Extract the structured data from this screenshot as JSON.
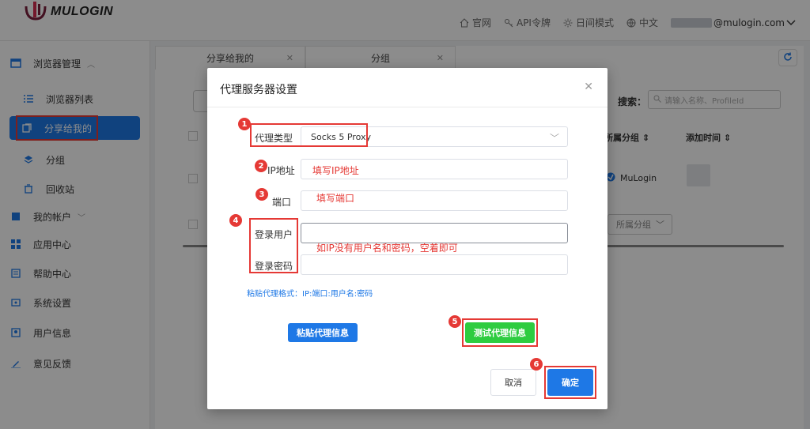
{
  "header": {
    "logo_text": "MULOGIN",
    "nav": [
      {
        "label": "官网",
        "icon": "home-icon"
      },
      {
        "label": "API令牌",
        "icon": "key-icon"
      },
      {
        "label": "日间模式",
        "icon": "sun-icon"
      },
      {
        "label": "中文",
        "icon": "globe-icon"
      }
    ],
    "email_suffix": "@mulogin.com"
  },
  "sidebar": {
    "browser_mgmt": "浏览器管理",
    "browser_list": "浏览器列表",
    "shared_with_me": "分享给我的",
    "groups": "分组",
    "recycle_bin": "回收站",
    "my_account": "我的帐户",
    "app_center": "应用中心",
    "help_center": "帮助中心",
    "system_settings": "系统设置",
    "user_info": "用户信息",
    "feedback": "意见反馈"
  },
  "tabs": [
    {
      "label": "分享给我的"
    },
    {
      "label": "分组"
    }
  ],
  "table": {
    "search_label": "搜索：",
    "search_placeholder": "请输入名称、ProfileId",
    "col_group": "所属分组",
    "col_added": "添加时间",
    "row_group": "MuLogin",
    "group_filter": "所属分组"
  },
  "modal": {
    "title": "代理服务器设置",
    "proxy_type_label": "代理类型",
    "proxy_type_value": "Socks 5 Proxy",
    "ip_label": "IP地址",
    "ip_note": "填写IP地址",
    "port_label": "端口",
    "port_note": "填写端口",
    "user_label": "登录用户",
    "password_label": "登录密码",
    "credentials_note": "如IP没有用户名和密码，空着即可",
    "paste_hint": "粘贴代理格式：IP:端口:用户名:密码",
    "paste_button": "粘贴代理信息",
    "test_button": "测试代理信息",
    "cancel_button": "取消",
    "ok_button": "确定"
  },
  "callouts": [
    "1",
    "2",
    "3",
    "4",
    "5",
    "6"
  ],
  "colors": {
    "accent": "#1e78e6",
    "highlight": "#e53935",
    "test": "#2ecc40"
  }
}
